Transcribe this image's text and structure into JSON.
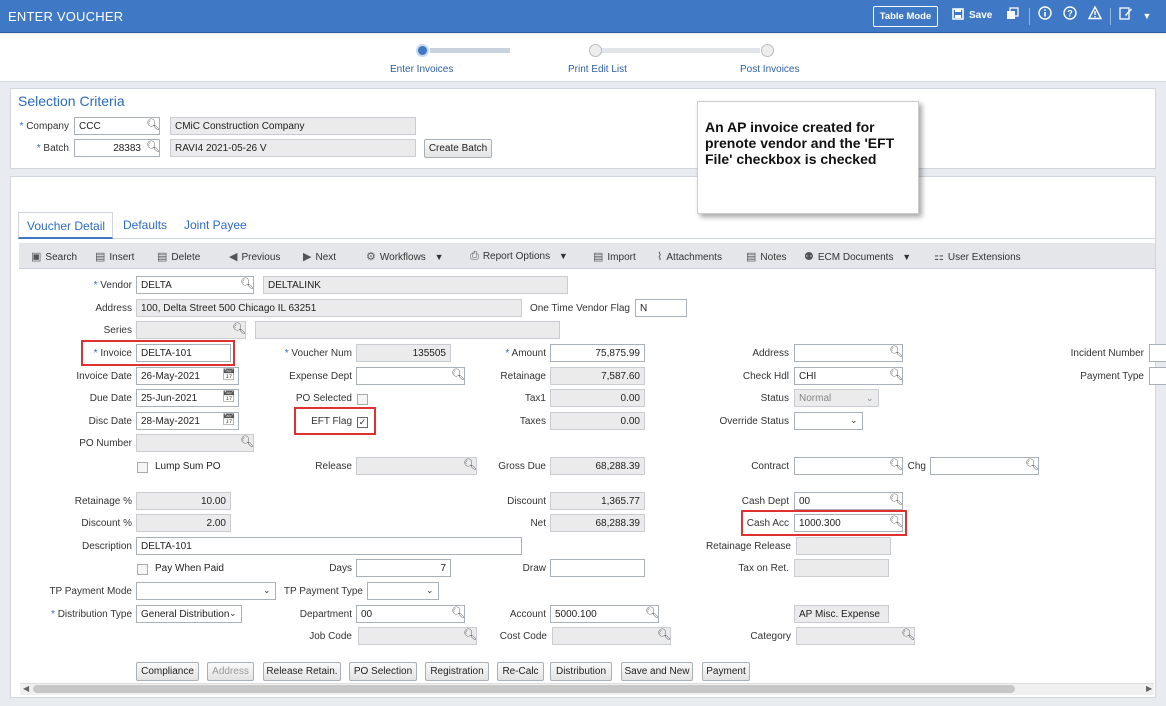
{
  "header": {
    "title": "ENTER VOUCHER",
    "table_mode_label": "Table Mode",
    "save_label": "Save"
  },
  "stepper": {
    "steps": [
      {
        "label": "Enter Invoices",
        "active": true
      },
      {
        "label": "Print Edit List",
        "active": false
      },
      {
        "label": "Post Invoices",
        "active": false
      }
    ]
  },
  "selection": {
    "title": "Selection Criteria",
    "company_label": "Company",
    "company_value": "CCC",
    "company_name": "CMiC Construction Company",
    "batch_label": "Batch",
    "batch_value": "28383",
    "batch_desc": "RAVI4 2021-05-26 V",
    "create_batch_label": "Create Batch"
  },
  "callout": {
    "text": "An AP invoice created for prenote vendor and the 'EFT File' checkbox is checked"
  },
  "tabs": [
    "Voucher Detail",
    "Defaults",
    "Joint Payee"
  ],
  "toolbar": {
    "search": "Search",
    "insert": "Insert",
    "delete": "Delete",
    "previous": "Previous",
    "next": "Next",
    "workflows": "Workflows",
    "report_options": "Report Options",
    "import": "Import",
    "attachments": "Attachments",
    "notes": "Notes",
    "ecm_documents": "ECM Documents",
    "user_extensions": "User Extensions"
  },
  "form": {
    "vendor_label": "Vendor",
    "vendor_value": "DELTA",
    "vendor_name": "DELTALINK",
    "address_label": "Address",
    "address_value": "100, Delta Street 500 Chicago IL 63251",
    "one_time_label": "One Time Vendor Flag",
    "one_time_value": "N",
    "series_label": "Series",
    "series_value": "",
    "series_desc": "",
    "invoice_label": "Invoice",
    "invoice_value": "DELTA-101",
    "voucher_num_label": "Voucher Num",
    "voucher_num_value": "135505",
    "amount_label": "Amount",
    "amount_value": "75,875.99",
    "address2_label": "Address",
    "address2_value": "",
    "incident_label": "Incident Number",
    "invoice_date_label": "Invoice Date",
    "invoice_date_value": "26-May-2021",
    "expense_dept_label": "Expense Dept",
    "expense_dept_value": "",
    "retainage_label": "Retainage",
    "retainage_value": "7,587.60",
    "check_hdl_label": "Check Hdl",
    "check_hdl_value": "CHI",
    "payment_type_label": "Payment Type",
    "due_date_label": "Due Date",
    "due_date_value": "25-Jun-2021",
    "po_selected_label": "PO Selected",
    "tax1_label": "Tax1",
    "tax1_value": "0.00",
    "status_label": "Status",
    "status_value": "Normal",
    "disc_date_label": "Disc Date",
    "disc_date_value": "28-May-2021",
    "eft_flag_label": "EFT Flag",
    "eft_flag_checked": true,
    "taxes_label": "Taxes",
    "taxes_value": "0.00",
    "override_status_label": "Override Status",
    "override_status_value": "",
    "po_number_label": "PO Number",
    "po_number_value": "",
    "lump_sum_label": "Lump Sum PO",
    "release_label": "Release",
    "release_value": "",
    "gross_due_label": "Gross Due",
    "gross_due_value": "68,288.39",
    "contract_label": "Contract",
    "contract_value": "",
    "chg_label": "Chg",
    "chg_value": "",
    "retainage_pct_label": "Retainage %",
    "retainage_pct_value": "10.00",
    "discount_label": "Discount",
    "discount_value": "1,365.77",
    "cash_dept_label": "Cash Dept",
    "cash_dept_value": "00",
    "discount_pct_label": "Discount %",
    "discount_pct_value": "2.00",
    "net_label": "Net",
    "net_value": "68,288.39",
    "cash_acc_label": "Cash Acc",
    "cash_acc_value": "1000.300",
    "description_label": "Description",
    "description_value": "DELTA-101",
    "retainage_release_label": "Retainage Release",
    "retainage_release_value": "",
    "pay_when_paid_label": "Pay When Paid",
    "days_label": "Days",
    "days_value": "7",
    "draw_label": "Draw",
    "draw_value": "",
    "tax_on_ret_label": "Tax on Ret.",
    "tax_on_ret_value": "",
    "tp_payment_mode_label": "TP Payment Mode",
    "tp_payment_mode_value": "",
    "tp_payment_type_label": "TP Payment Type",
    "tp_payment_type_value": "",
    "distribution_type_label": "Distribution Type",
    "distribution_type_value": "General Distribution",
    "department_label": "Department",
    "department_value": "00",
    "account_label": "Account",
    "account_value": "5000.100",
    "account_desc": "AP Misc. Expense",
    "job_code_label": "Job Code",
    "job_code_value": "",
    "cost_code_label": "Cost Code",
    "cost_code_value": "",
    "category_label": "Category",
    "category_value": ""
  },
  "bottom_buttons": {
    "compliance": "Compliance",
    "address": "Address",
    "release_retain": "Release Retain.",
    "po_selection": "PO Selection",
    "registration": "Registration",
    "recalc": "Re-Calc",
    "distribution": "Distribution",
    "save_and_new": "Save and New",
    "payment": "Payment"
  }
}
